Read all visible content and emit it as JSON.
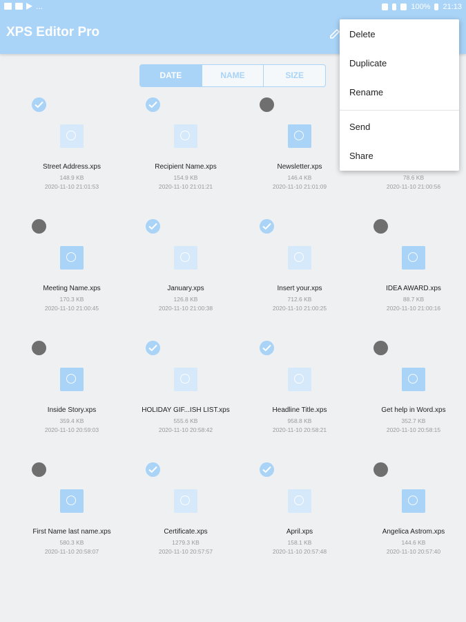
{
  "status_bar": {
    "battery": "100%",
    "time": "21:13",
    "dots": "..."
  },
  "app_bar": {
    "title": "XPS Editor Pro"
  },
  "sort_tabs": [
    {
      "label": "DATE",
      "active": true
    },
    {
      "label": "NAME",
      "active": false
    },
    {
      "label": "SIZE",
      "active": false
    }
  ],
  "files": [
    {
      "name": "Street Address.xps",
      "size": "148.9 KB",
      "date": "2020-11-10 21:01:53",
      "selected": true
    },
    {
      "name": "Recipient Name.xps",
      "size": "154.9 KB",
      "date": "2020-11-10 21:01:21",
      "selected": true
    },
    {
      "name": "Newsletter.xps",
      "size": "146.4 KB",
      "date": "2020-11-10 21:01:09",
      "selected": false
    },
    {
      "name": "",
      "size": "78.6 KB",
      "date": "2020-11-10 21:00:56",
      "selected": false
    },
    {
      "name": "Meeting Name.xps",
      "size": "170.3 KB",
      "date": "2020-11-10 21:00:45",
      "selected": false
    },
    {
      "name": "January.xps",
      "size": "126.8 KB",
      "date": "2020-11-10 21:00:38",
      "selected": true
    },
    {
      "name": "Insert your.xps",
      "size": "712.6 KB",
      "date": "2020-11-10 21:00:25",
      "selected": true
    },
    {
      "name": "IDEA AWARD.xps",
      "size": "88.7 KB",
      "date": "2020-11-10 21:00:16",
      "selected": false
    },
    {
      "name": "Inside Story.xps",
      "size": "359.4 KB",
      "date": "2020-11-10 20:59:03",
      "selected": false
    },
    {
      "name": "HOLIDAY GIF...ISH LIST.xps",
      "size": "555.6 KB",
      "date": "2020-11-10 20:58:42",
      "selected": true
    },
    {
      "name": "Headline Title.xps",
      "size": "958.8 KB",
      "date": "2020-11-10 20:58:21",
      "selected": true
    },
    {
      "name": "Get help in Word.xps",
      "size": "352.7 KB",
      "date": "2020-11-10 20:58:15",
      "selected": false
    },
    {
      "name": "First Name last name.xps",
      "size": "580.3 KB",
      "date": "2020-11-10 20:58:07",
      "selected": false
    },
    {
      "name": "Certificate.xps",
      "size": "1279.3 KB",
      "date": "2020-11-10 20:57:57",
      "selected": true
    },
    {
      "name": "April.xps",
      "size": "158.1 KB",
      "date": "2020-11-10 20:57:48",
      "selected": true
    },
    {
      "name": "Angelica Astrom.xps",
      "size": "144.6 KB",
      "date": "2020-11-10 20:57:40",
      "selected": false
    }
  ],
  "context_menu": {
    "items": [
      "Delete",
      "Duplicate",
      "Rename",
      "Send",
      "Share"
    ]
  },
  "colors": {
    "accent": "#a9d3f7",
    "unselected": "#6f6f6f",
    "background": "#eef0f2"
  }
}
